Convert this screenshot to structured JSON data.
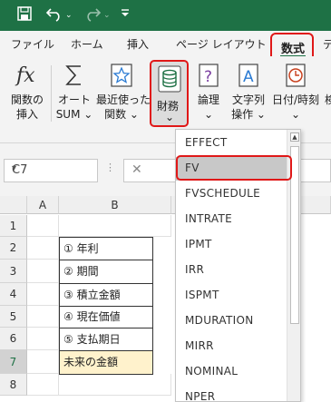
{
  "qat": {
    "save_icon": "save-icon",
    "undo_icon": "undo-icon",
    "redo_icon": "redo-icon",
    "customize_icon": "customize-qat-icon"
  },
  "tabs": {
    "file": "ファイル",
    "home": "ホーム",
    "insert": "挿入",
    "page_layout": "ページ レイアウト",
    "formulas": "数式",
    "extra": "デ"
  },
  "ribbon": {
    "insert_function": [
      "関数の",
      "挿入"
    ],
    "autosum": [
      "オート",
      "SUM ⌄"
    ],
    "recently_used": [
      "最近使った",
      "関数 ⌄"
    ],
    "financial": [
      "財務",
      "⌄"
    ],
    "logical": [
      "論理",
      "⌄"
    ],
    "text": [
      "文字列",
      "操作 ⌄"
    ],
    "datetime": [
      "日付/時刻",
      "⌄"
    ],
    "more": "検"
  },
  "formula_bar": {
    "name_box": "C7",
    "dropdown_arrow": "▾",
    "dots": "⋮",
    "cancel_icon": "✕"
  },
  "grid": {
    "columns": [
      "A",
      "B"
    ],
    "rows": [
      "1",
      "2",
      "3",
      "4",
      "5",
      "6",
      "7",
      "8"
    ],
    "b_cells": [
      "① 年利",
      "② 期間",
      "③ 積立金額",
      "④ 現在価値",
      "⑤ 支払期日",
      "未来の金額"
    ]
  },
  "financial_menu": {
    "items": [
      "EFFECT",
      "FV",
      "FVSCHEDULE",
      "INTRATE",
      "IPMT",
      "IRR",
      "ISPMT",
      "MDURATION",
      "MIRR",
      "NOMINAL",
      "NPER"
    ],
    "selected": "FV"
  },
  "colors": {
    "excel_green": "#1e7145",
    "highlight_red": "#e01818",
    "result_fill": "#fff2cc",
    "selected_item": "#c8c8c8"
  }
}
